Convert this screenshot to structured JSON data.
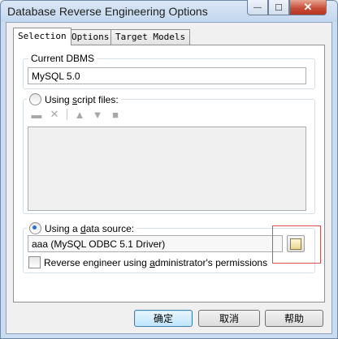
{
  "window": {
    "title": "Database Reverse Engineering Options",
    "minimize_glyph": "—",
    "maximize_glyph": "☐",
    "close_glyph": "✕"
  },
  "tabs": [
    {
      "label": "Selection",
      "active": true
    },
    {
      "label": "Options",
      "active": false
    },
    {
      "label": "Target Models",
      "active": false
    }
  ],
  "current_dbms": {
    "group_label": "Current DBMS",
    "value": "MySQL 5.0"
  },
  "script_files": {
    "label_prefix": "Using ",
    "label_accel": "s",
    "label_suffix": "cript files:",
    "selected": false,
    "toolbar_icons": [
      "add-file-icon",
      "delete-icon",
      "move-up-icon",
      "move-down-icon",
      "comment-icon"
    ]
  },
  "data_source": {
    "label_prefix": "Using a ",
    "label_accel": "d",
    "label_suffix": "ata source:",
    "selected": true,
    "value": "aaa (MySQL ODBC 5.1 Driver)",
    "browse_icon": "browse-data-source-icon",
    "admin_check_prefix": "Reverse engineer using ",
    "admin_check_accel": "a",
    "admin_check_suffix": "dministrator's permissions",
    "admin_checked": false
  },
  "buttons": {
    "ok": "确定",
    "cancel": "取消",
    "help": "帮助"
  },
  "colors": {
    "highlight_box": "#d85050",
    "title_bar": "#c9dcf0",
    "default_button": "#bee6fd"
  }
}
